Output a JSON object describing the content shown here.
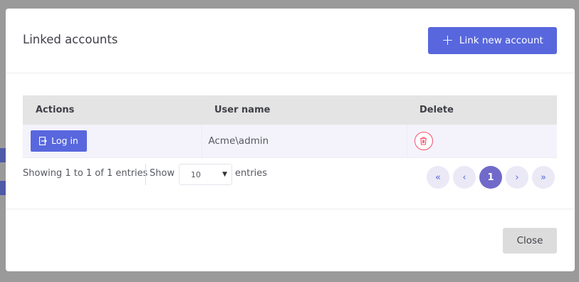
{
  "modal": {
    "title": "Linked accounts",
    "link_new_label": "Link new account",
    "close_label": "Close"
  },
  "table": {
    "columns": [
      "Actions",
      "User name",
      "Delete"
    ],
    "rows": [
      {
        "action_label": "Log in",
        "user_name": "Acme\\admin"
      }
    ]
  },
  "pagination": {
    "info": "Showing 1 to 1 of 1 entries",
    "show_label": "Show",
    "page_size": "10",
    "entries_label": "entries",
    "first": "«",
    "prev": "‹",
    "current_page": "1",
    "next": "›",
    "last": "»"
  },
  "colors": {
    "primary": "#5867dd",
    "active_page": "#716aca",
    "danger": "#f4516c"
  }
}
